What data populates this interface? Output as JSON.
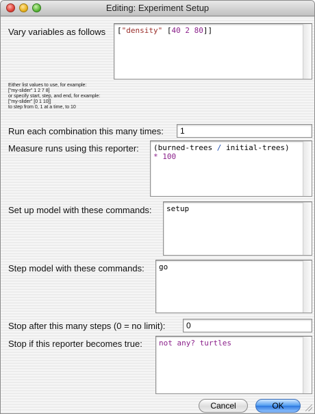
{
  "window": {
    "title": "Editing: Experiment Setup"
  },
  "vary": {
    "label": "Vary variables as follows",
    "value_parts": [
      "[",
      "\"density\"",
      " [",
      "40 2 80",
      "]]"
    ],
    "help": [
      "Either list values to use, for example:",
      "[\"my-slider\" 1 2 7 8]",
      "or specify start, step, and end, for example:",
      "[\"my-slider\" [0 1 10]]",
      "to step from 0, 1 at a time, to 10"
    ]
  },
  "repetitions": {
    "label": "Run each combination this many times:",
    "value": "1"
  },
  "measure": {
    "label": "Measure runs using this reporter:",
    "line1_parts": [
      "(burned-trees ",
      "/",
      " initial-trees)"
    ],
    "line2_parts": [
      "*",
      " ",
      "100"
    ]
  },
  "setup": {
    "label": "Set up model with these commands:",
    "value": "setup"
  },
  "go": {
    "label": "Step model with these commands:",
    "value": "go"
  },
  "time_limit": {
    "label": "Stop after this many steps (0 = no limit):",
    "value": "0"
  },
  "exit_condition": {
    "label": "Stop if this reporter becomes true:",
    "value": "not any? turtles"
  },
  "buttons": {
    "cancel": "Cancel",
    "ok": "OK"
  },
  "colors": {
    "string": "#9a2e2a",
    "number": "#8a1f8a",
    "keyword": "#1f4fb0",
    "ok_button": "#2d78e0"
  }
}
